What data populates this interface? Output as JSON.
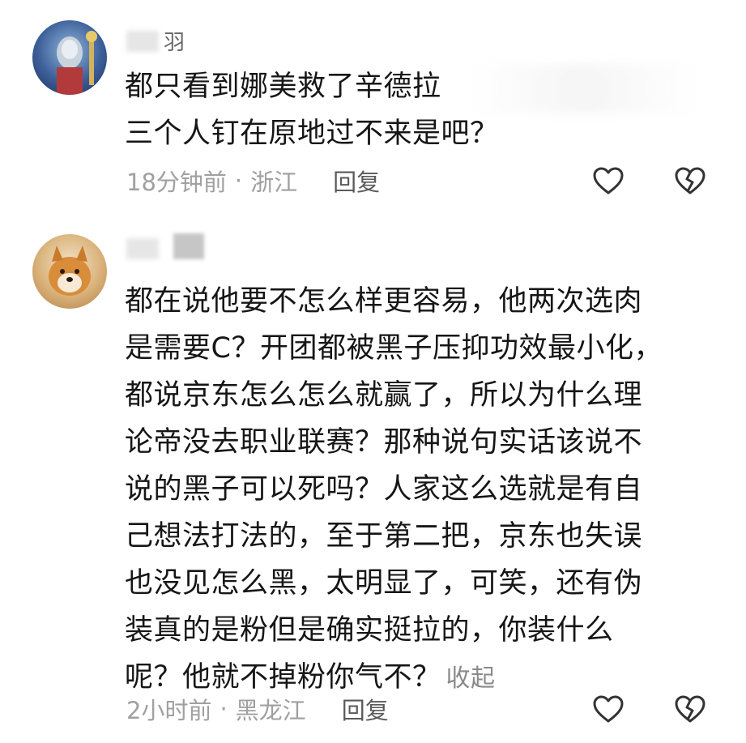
{
  "comments": [
    {
      "username_visible": "羽",
      "text_lines": [
        "都只看到娜美救了辛德拉",
        "三个人钉在原地过不来是吧？"
      ],
      "time": "18分钟前",
      "location": "浙江",
      "reply_label": "回复",
      "like_icon": "heart-outline-icon",
      "dislike_icon": "broken-heart-icon"
    },
    {
      "text_lines": [
        "都在说他要不怎么样更容易，他两次选肉",
        "是需要C？开团都被黑子压抑功效最小化，",
        "都说京东怎么怎么就赢了，所以为什么理",
        "论帝没去职业联赛？那种说句实话该说不",
        "说的黑子可以死吗？人家这么选就是有自",
        "己想法打法的，至于第二把，京东也失误",
        "也没见怎么黑，太明显了，可笑，还有伪",
        "装真的是粉但是确实挺拉的，你装什么",
        "呢？他就不掉粉你气不？"
      ],
      "collapse_label": "收起",
      "time": "2小时前",
      "location": "黑龙江",
      "reply_label": "回复",
      "like_icon": "heart-outline-icon",
      "dislike_icon": "broken-heart-icon"
    }
  ],
  "separator": "·"
}
